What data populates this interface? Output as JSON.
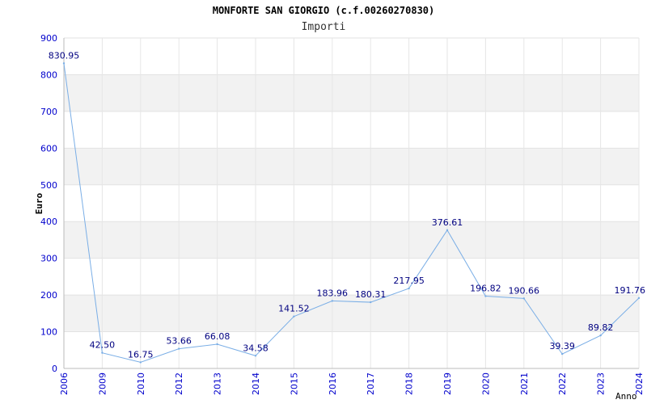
{
  "chart_data": {
    "type": "line",
    "title": "MONFORTE SAN GIORGIO (c.f.00260270830)",
    "subtitle": "Importi",
    "xlabel": "Anno",
    "ylabel": "Euro",
    "ylim": [
      0,
      900
    ],
    "yticks": [
      0,
      100,
      200,
      300,
      400,
      500,
      600,
      700,
      800,
      900
    ],
    "grid": "horizontal alternating bands",
    "categories": [
      "2006",
      "2009",
      "2010",
      "2012",
      "2013",
      "2014",
      "2015",
      "2016",
      "2017",
      "2018",
      "2019",
      "2020",
      "2021",
      "2022",
      "2023",
      "2024"
    ],
    "values": [
      830.95,
      42.5,
      16.75,
      53.66,
      66.08,
      34.58,
      141.52,
      183.96,
      180.31,
      217.95,
      376.61,
      196.82,
      190.66,
      39.39,
      89.82,
      191.76
    ],
    "labels": [
      "830.95",
      "42.50",
      "16.75",
      "53.66",
      "66.08",
      "34.58",
      "141.52",
      "183.96",
      "180.31",
      "217.95",
      "376.61",
      "196.82",
      "190.66",
      "39.39",
      "89.82",
      "191.76"
    ],
    "colors": {
      "line": "#7aaee6",
      "band": "#f2f2f2",
      "axis_text": "#0000cc",
      "label_text": "#000080",
      "title_text": "#000000"
    }
  }
}
